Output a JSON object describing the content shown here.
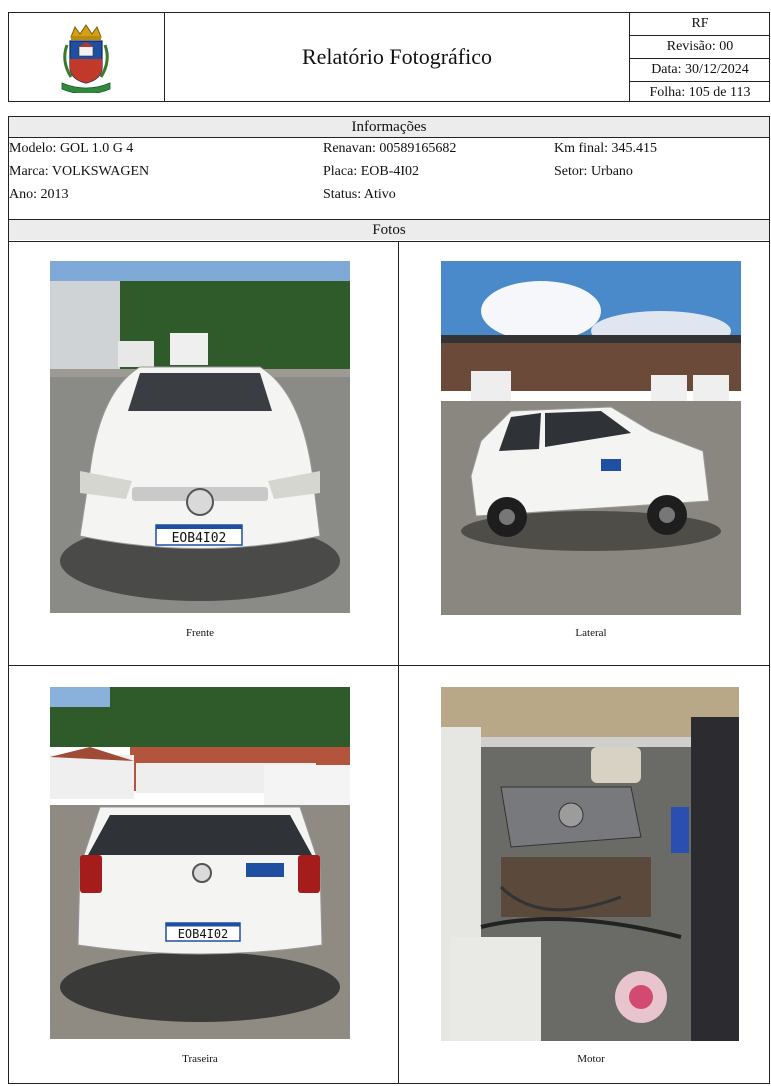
{
  "header": {
    "title": "Relatório Fotográfico",
    "code": "RF",
    "revision": "Revisão: 00",
    "date": "Data: 30/12/2024",
    "sheet": "Folha: 105 de 113",
    "logo_icon": "municipal-coat-of-arms-icon",
    "colors": {
      "shield_blue": "#1f4fa0",
      "shield_red": "#c0392b",
      "crown_gold": "#d4a017",
      "ribbon_green": "#2e8b3e"
    }
  },
  "info": {
    "section_title": "Informações",
    "modelo": "Modelo: GOL 1.0 G 4",
    "marca": "Marca: VOLKSWAGEN",
    "ano": "Ano: 2013",
    "renavan": "Renavan: 00589165682",
    "placa": "Placa: EOB-4I02",
    "status": "Status: Ativo",
    "km_final": "Km final: 345.415",
    "setor": "Setor: Urbano"
  },
  "fotos": {
    "section_title": "Fotos",
    "plate_text": "EOB4I02",
    "items": [
      {
        "caption": "Frente"
      },
      {
        "caption": "Lateral"
      },
      {
        "caption": "Traseira"
      },
      {
        "caption": "Motor"
      }
    ]
  }
}
